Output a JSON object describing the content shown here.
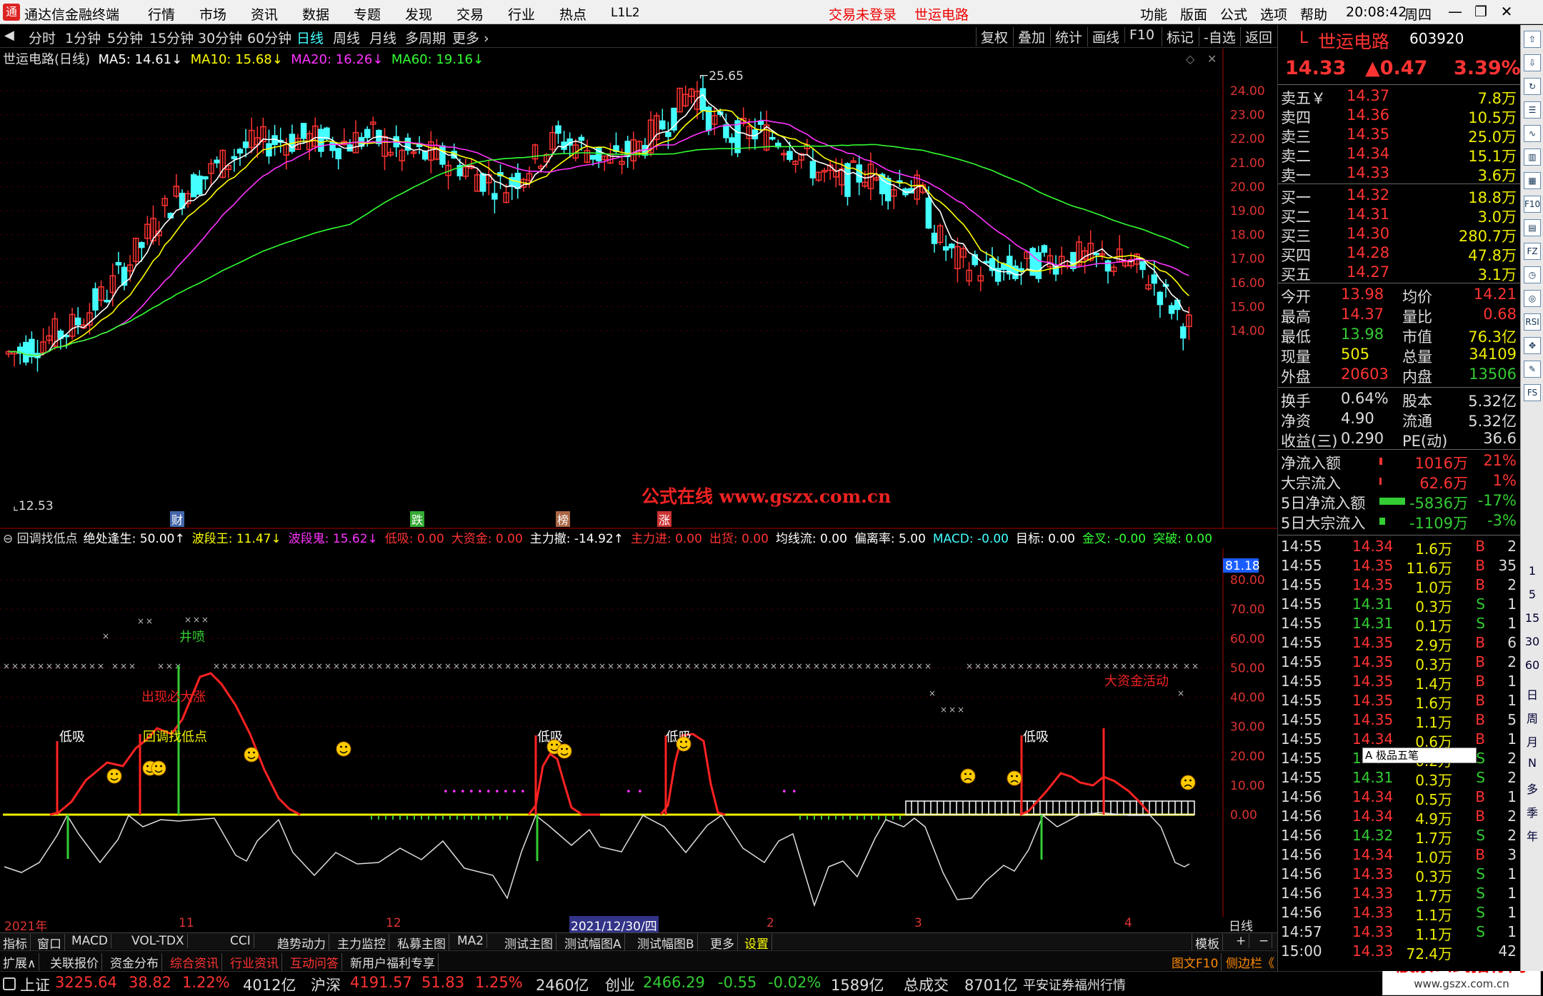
{
  "app": {
    "title": "通达信金融终端",
    "menus": [
      "行情",
      "市场",
      "资讯",
      "数据",
      "专题",
      "发现",
      "交易",
      "行业",
      "热点",
      "L1L2"
    ],
    "login": "交易未登录",
    "stock_title": "世运电路",
    "right_menus": [
      "功能",
      "版面",
      "公式",
      "选项",
      "帮助"
    ],
    "time": "20:08:42",
    "weekday": "周四"
  },
  "toolbar": {
    "periods": [
      "分时",
      "1分钟",
      "5分钟",
      "15分钟",
      "30分钟",
      "60分钟",
      "日线",
      "周线",
      "月线",
      "多周期",
      "更多 ›"
    ],
    "active": "日线",
    "right": [
      "复权",
      "叠加",
      "统计",
      "画线",
      "F10",
      "标记",
      "-自选",
      "返回"
    ]
  },
  "chart": {
    "name": "世运电路(日线)",
    "ma": [
      {
        "label": "MA5: 14.61↓",
        "color": "#ffffff"
      },
      {
        "label": "MA10: 15.68↓",
        "color": "#ffff00"
      },
      {
        "label": "MA20: 16.26↓",
        "color": "#ff33ff"
      },
      {
        "label": "MA60: 19.16↓",
        "color": "#33ff33"
      }
    ],
    "high_label": "25.65",
    "low_label": "12.53",
    "yticks": [
      "24.00",
      "23.00",
      "22.00",
      "21.00",
      "20.00",
      "19.00",
      "18.00",
      "17.00",
      "16.00",
      "15.00",
      "14.00"
    ],
    "watermark": "公式在线 www.gszx.com.cn",
    "markers": [
      "财",
      "跌",
      "榜",
      "涨"
    ]
  },
  "indicator": {
    "name": "回调找低点",
    "items": [
      {
        "t": "绝处逢生: 50.00↑",
        "c": "#ffffff"
      },
      {
        "t": "波段王: 11.47↓",
        "c": "#ffff00"
      },
      {
        "t": "波段鬼: 15.62↓",
        "c": "#ff33ff"
      },
      {
        "t": "低吸: 0.00",
        "c": "#ff3333"
      },
      {
        "t": "大资金: 0.00",
        "c": "#ff3333"
      },
      {
        "t": "主力撤: -14.92↑",
        "c": "#ffffff"
      },
      {
        "t": "主力进: 0.00",
        "c": "#ff3333"
      },
      {
        "t": "出货: 0.00",
        "c": "#ff3333"
      },
      {
        "t": "均线流: 0.00",
        "c": "#ffffff"
      },
      {
        "t": "偏离率: 5.00",
        "c": "#ffffff"
      },
      {
        "t": "MACD: -0.00",
        "c": "#44ffff"
      },
      {
        "t": "目标: 0.00",
        "c": "#ffffff"
      },
      {
        "t": "金叉: -0.00",
        "c": "#33ff33"
      },
      {
        "t": "突破: 0.00",
        "c": "#33ff33"
      }
    ],
    "yticks": [
      "80.00",
      "70.00",
      "60.00",
      "50.00",
      "40.00",
      "30.00",
      "20.00",
      "10.00",
      "0.00"
    ],
    "current": "81.18",
    "labels": {
      "jingpen": "井喷",
      "bixian": "出现必大涨",
      "huidiao": "回调找低点",
      "dixi": "低吸",
      "dazijin": "大资金活动"
    }
  },
  "xaxis": {
    "labels": [
      "2021年",
      "11",
      "12",
      "2021/12/30/四",
      "2",
      "3",
      "4"
    ],
    "period": "日线"
  },
  "tabs1": [
    "指标",
    "窗口",
    "MACD",
    "VOL-TDX",
    "CCI",
    "趋势动力",
    "主力监控",
    "私募主图",
    "MA2",
    "测试主图",
    "测试幅图A",
    "测试幅图B",
    "更多",
    "设置"
  ],
  "tabs1_right": "模板",
  "tabs2": [
    "扩展∧",
    "关联报价",
    "资金分布",
    "综合资讯",
    "行业资讯",
    "互动问答",
    "新用户福利专享"
  ],
  "tabs2_right": [
    "图文F10",
    "侧边栏《",
    "笔",
    "价",
    "细",
    "势"
  ],
  "status": {
    "items": [
      {
        "name": "上证",
        "v": "3225.64",
        "d": "38.82",
        "p": "1.22%",
        "amt": "4012亿"
      },
      {
        "name": "沪深",
        "v": "4191.57",
        "d": "51.83",
        "p": "1.25%",
        "amt": "2460亿"
      },
      {
        "name": "创业",
        "v": "2466.29",
        "d": "-0.55",
        "p": "-0.02%",
        "amt": "1589亿"
      }
    ],
    "total_label": "总成交",
    "total": "8701亿",
    "broker": "平安证券福州行情",
    "logo": "股票公式指标网",
    "logo_url": "www.gszx.com.cn"
  },
  "quote": {
    "flag": "L",
    "name": "世运电路",
    "code": "603920",
    "price": "14.33",
    "change": "▲0.47",
    "pct": "3.39%",
    "asks": [
      {
        "l": "卖五￥",
        "p": "14.37",
        "v": "7.8万"
      },
      {
        "l": "卖四",
        "p": "14.36",
        "v": "10.5万"
      },
      {
        "l": "卖三",
        "p": "14.35",
        "v": "25.0万"
      },
      {
        "l": "卖二",
        "p": "14.34",
        "v": "15.1万"
      },
      {
        "l": "卖一",
        "p": "14.33",
        "v": "3.6万"
      }
    ],
    "bids": [
      {
        "l": "买一",
        "p": "14.32",
        "v": "18.8万"
      },
      {
        "l": "买二",
        "p": "14.31",
        "v": "3.0万"
      },
      {
        "l": "买三",
        "p": "14.30",
        "v": "280.7万"
      },
      {
        "l": "买四",
        "p": "14.28",
        "v": "47.8万"
      },
      {
        "l": "买五",
        "p": "14.27",
        "v": "3.1万"
      }
    ],
    "stats": [
      [
        "今开",
        "13.98",
        "均价",
        "14.21"
      ],
      [
        "最高",
        "14.37",
        "量比",
        "0.68"
      ],
      [
        "最低",
        "13.98",
        "市值",
        "76.3亿"
      ],
      [
        "现量",
        "505",
        "总量",
        "34109"
      ],
      [
        "外盘",
        "20603",
        "内盘",
        "13506"
      ]
    ],
    "stats2": [
      [
        "换手",
        "0.64%",
        "股本",
        "5.32亿"
      ],
      [
        "净资",
        "4.90",
        "流通",
        "5.32亿"
      ],
      [
        "收益(三)",
        "0.290",
        "PE(动)",
        "36.6"
      ]
    ],
    "flows": [
      [
        "净流入额",
        "1016万",
        "21%"
      ],
      [
        "大宗流入",
        "62.6万",
        "1%"
      ],
      [
        "5日净流入额",
        "-5836万",
        "-17%"
      ],
      [
        "5日大宗流入",
        "-1109万",
        "-3%"
      ]
    ],
    "ticks": [
      [
        "14:55",
        "14.34",
        "1.6万",
        "B",
        "2"
      ],
      [
        "14:55",
        "14.35",
        "11.6万",
        "B",
        "35"
      ],
      [
        "14:55",
        "14.35",
        "1.0万",
        "B",
        "2"
      ],
      [
        "14:55",
        "14.31",
        "0.3万",
        "S",
        "1"
      ],
      [
        "14:55",
        "14.31",
        "0.1万",
        "S",
        "1"
      ],
      [
        "14:55",
        "14.35",
        "2.9万",
        "B",
        "6"
      ],
      [
        "14:55",
        "14.35",
        "0.3万",
        "B",
        "2"
      ],
      [
        "14:55",
        "14.35",
        "1.4万",
        "B",
        "1"
      ],
      [
        "14:55",
        "14.35",
        "1.6万",
        "B",
        "1"
      ],
      [
        "14:55",
        "14.35",
        "1.1万",
        "B",
        "5"
      ],
      [
        "14:55",
        "14.34",
        "0.6万",
        "B",
        "1"
      ],
      [
        "14:55",
        "14.32",
        "0.2万",
        "S",
        "2"
      ],
      [
        "14:55",
        "14.31",
        "0.3万",
        "S",
        "2"
      ],
      [
        "14:56",
        "14.34",
        "0.5万",
        "B",
        "1"
      ],
      [
        "14:56",
        "14.34",
        "4.9万",
        "B",
        "2"
      ],
      [
        "14:56",
        "14.32",
        "1.7万",
        "S",
        "2"
      ],
      [
        "14:56",
        "14.34",
        "1.0万",
        "B",
        "3"
      ],
      [
        "14:56",
        "14.33",
        "0.3万",
        "S",
        "1"
      ],
      [
        "14:56",
        "14.33",
        "1.7万",
        "S",
        "1"
      ],
      [
        "14:56",
        "14.33",
        "1.1万",
        "S",
        "1"
      ],
      [
        "14:57",
        "14.33",
        "1.1万",
        "S",
        "1"
      ],
      [
        "15:00",
        "14.33",
        "72.4万",
        "",
        "42"
      ]
    ],
    "popup": "A 极品五笔"
  },
  "rightbar": [
    "日",
    "周",
    "月",
    "N",
    "多",
    "季",
    "年"
  ]
}
